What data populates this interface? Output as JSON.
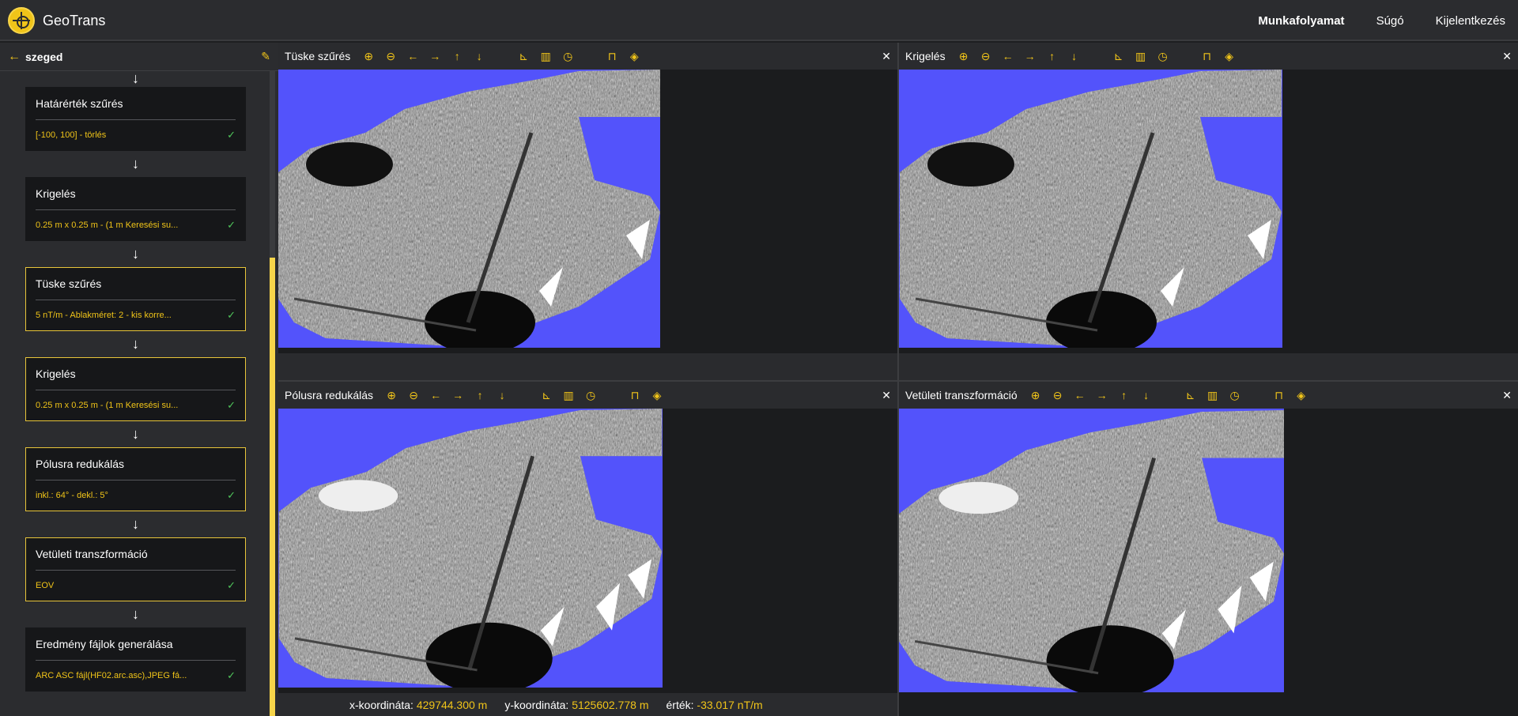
{
  "app": {
    "title": "GeoTrans"
  },
  "nav": {
    "items": [
      "Munkafolyamat",
      "Súgó",
      "Kijelentkezés"
    ]
  },
  "sidebar": {
    "project": "szeged",
    "steps": [
      {
        "title": "Határérték szűrés",
        "summary": "[-100, 100] - törlés",
        "highlighted": false
      },
      {
        "title": "Krigelés",
        "summary": "0.25 m x 0.25 m - (1 m Keresési su...",
        "highlighted": false
      },
      {
        "title": "Tüske szűrés",
        "summary": "5 nT/m - Ablakméret: 2 - kis korre...",
        "highlighted": true
      },
      {
        "title": "Krigelés",
        "summary": "0.25 m x 0.25 m - (1 m Keresési su...",
        "highlighted": true
      },
      {
        "title": "Pólusra redukálás",
        "summary": "inkl.: 64° - dekl.: 5°",
        "highlighted": true
      },
      {
        "title": "Vetületi transzformáció",
        "summary": "EOV",
        "highlighted": true
      },
      {
        "title": "Eredmény fájlok generálása",
        "summary": "ARC ASC fájl(HF02.arc.asc),JPEG fá...",
        "highlighted": false
      }
    ]
  },
  "panels": [
    {
      "title": "Tüske szűrés"
    },
    {
      "title": "Krigelés"
    },
    {
      "title": "Pólusra redukálás"
    },
    {
      "title": "Vetületi transzformáció"
    }
  ],
  "toolbar_icons": [
    "zoom-in-icon",
    "zoom-out-icon",
    "arrow-left-icon",
    "arrow-right-icon",
    "arrow-up-icon",
    "arrow-down-icon",
    "axis-icon",
    "histogram-icon",
    "clock-icon",
    "lock-icon",
    "layers-icon"
  ],
  "status": {
    "x_label": "x-koordináta:",
    "x_value": "429744.300 m",
    "y_label": "y-koordináta:",
    "y_value": "5125602.778 m",
    "v_label": "érték:",
    "v_value": "-33.017 nT/m"
  },
  "colors": {
    "accent": "#f0c419",
    "map_background": "#5353fb",
    "success": "#4fc65a"
  }
}
